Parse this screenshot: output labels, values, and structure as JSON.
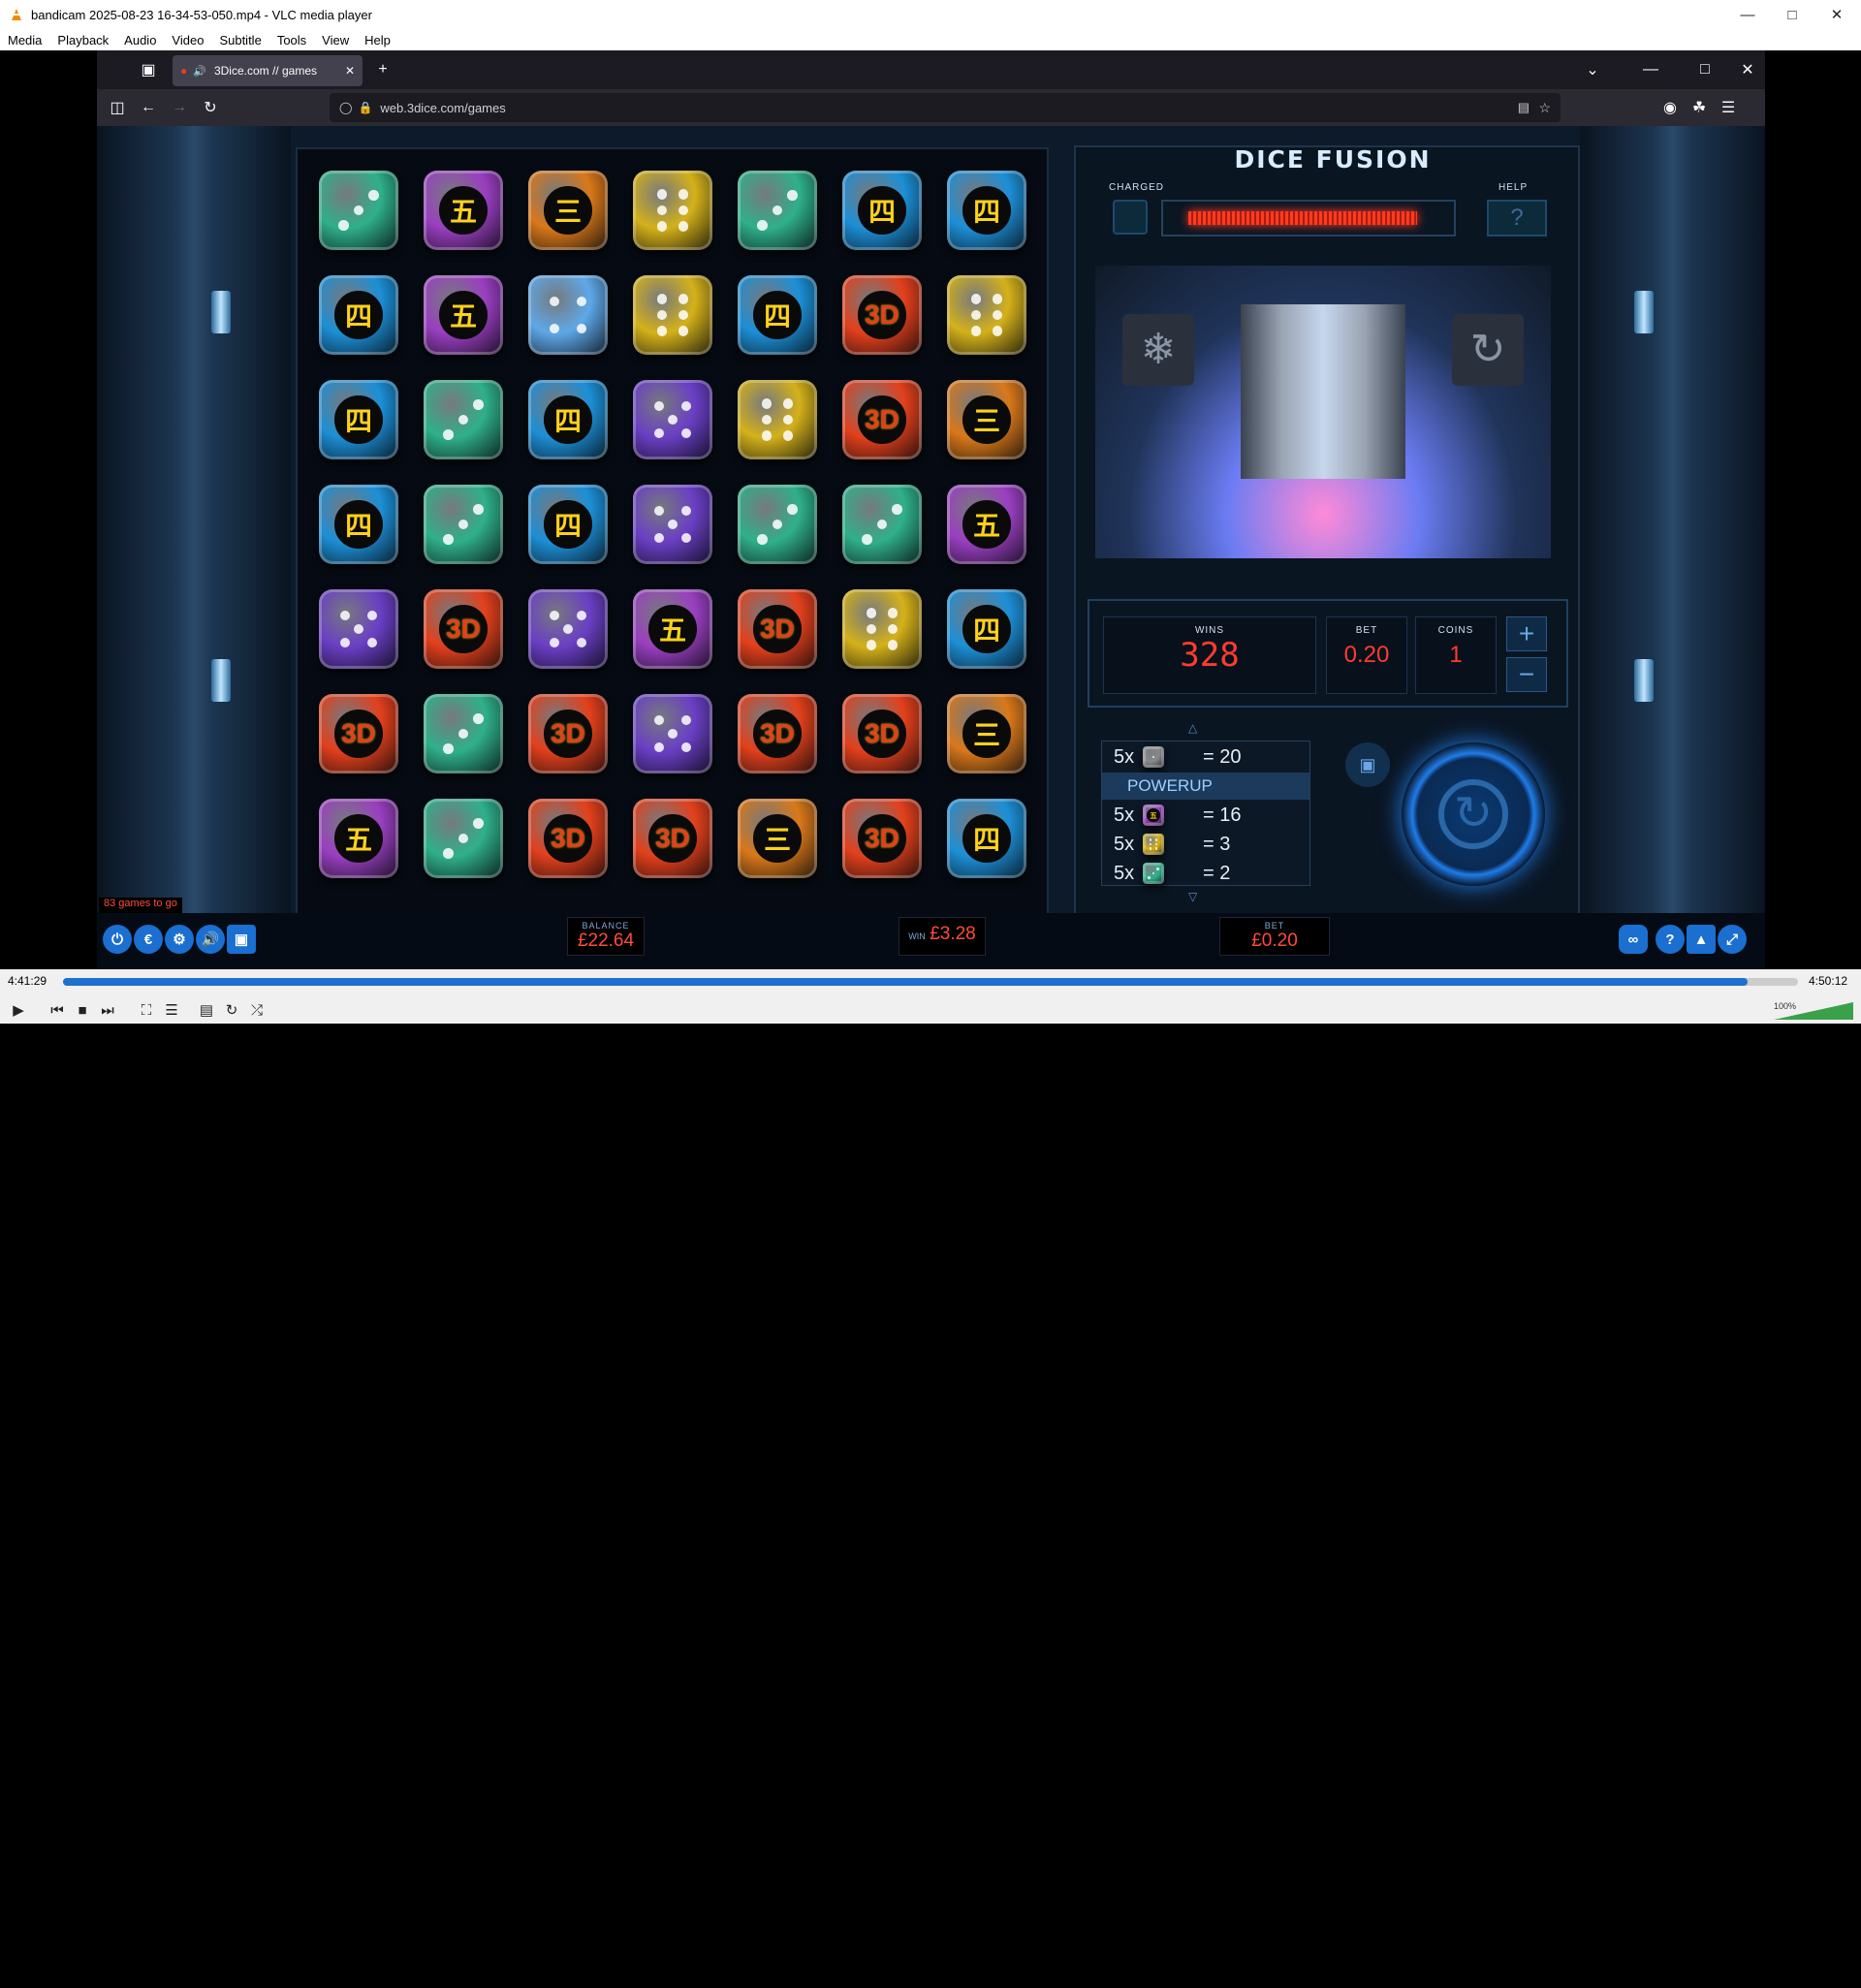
{
  "window": {
    "title": "bandicam 2025-08-23 16-34-53-050.mp4 - VLC media player"
  },
  "menu": [
    "Media",
    "Playback",
    "Audio",
    "Video",
    "Subtitle",
    "Tools",
    "View",
    "Help"
  ],
  "browser": {
    "tab_title": "3Dice.com // games",
    "url": "web.3dice.com/games"
  },
  "game": {
    "title": "DICE FUSION",
    "charged_label": "CHARGED",
    "help_label": "HELP",
    "help_glyph": "?",
    "wins_label": "WINS",
    "wins_value": "328",
    "bet_label": "BET",
    "bet_value": "0.20",
    "coins_label": "COINS",
    "coins_value": "1",
    "plus": "+",
    "minus": "−",
    "paytable": [
      {
        "count": "5x",
        "die": "3d",
        "eq": "= 20"
      },
      {
        "count": "",
        "die": "",
        "eq": "POWERUP"
      },
      {
        "count": "5x",
        "die": "purple-five",
        "eq": "= 16"
      },
      {
        "count": "5x",
        "die": "gold",
        "eq": "= 3"
      },
      {
        "count": "5x",
        "die": "green",
        "eq": "= 2"
      }
    ],
    "grid": [
      [
        "green",
        "purple-five",
        "orange-three",
        "gold",
        "green",
        "blue-four",
        "blue-four"
      ],
      [
        "blue-four",
        "purple-five",
        "lightblue",
        "gold",
        "blue-four",
        "red-3d",
        "gold"
      ],
      [
        "blue-four",
        "green",
        "blue-four",
        "violet",
        "gold",
        "red-3d",
        "orange-three"
      ],
      [
        "blue-four",
        "green",
        "blue-four",
        "violet",
        "green",
        "green",
        "purple-five"
      ],
      [
        "violet",
        "red-3d",
        "violet",
        "purple-five",
        "red-3d",
        "gold",
        "blue-four"
      ],
      [
        "red-3d",
        "green",
        "red-3d",
        "violet",
        "red-3d",
        "red-3d",
        "orange-three"
      ],
      [
        "purple-five",
        "green",
        "red-3d",
        "red-3d",
        "orange-three",
        "red-3d",
        "blue-four"
      ]
    ],
    "die_glyphs": {
      "purple-five": "五",
      "blue-four": "四",
      "orange-three": "三",
      "red-3d": "3D"
    },
    "colors": {
      "green": "#2fb08a",
      "purple-five": "#9a3fc0",
      "orange-three": "#d9781a",
      "gold": "#d4b11a",
      "blue-four": "#1d8fd6",
      "lightblue": "#5ea8e8",
      "red-3d": "#e2401c",
      "violet": "#6a3fc4"
    },
    "hud": {
      "games_to_go": "83 games to go",
      "balance_label": "BALANCE",
      "balance_value": "£22.64",
      "win_label": "WIN",
      "win_value": "£3.28",
      "bet_label": "BET",
      "bet_value": "£0.20"
    }
  },
  "player": {
    "time_elapsed": "4:41:29",
    "time_total": "4:50:12",
    "progress": 0.971,
    "volume": "100%"
  }
}
